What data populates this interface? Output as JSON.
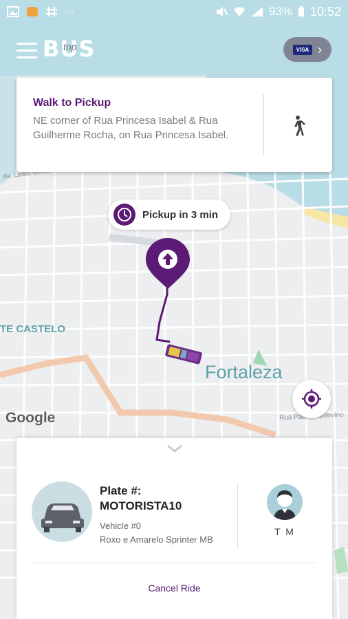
{
  "status_bar": {
    "battery": "93%",
    "time": "10:52"
  },
  "header": {
    "logo_text": "BUS",
    "logo_sub": "top",
    "payment_card_brand": "VISA"
  },
  "walk_card": {
    "title": "Walk to Pickup",
    "description": "NE corner of Rua Princesa Isabel & Rua Guilherme Rocha, on Rua Princesa Isabel."
  },
  "pickup_eta": "Pickup in 3 min",
  "map": {
    "city_label": "Fortaleza",
    "district_label": "TE CASTELO",
    "street_label_1": "Av. Leste Oeste",
    "street_label_2": "Rua Padre Valdevino",
    "attribution": "Google"
  },
  "ride": {
    "plate_label": "Plate #:",
    "plate_value": "MOTORISTA10",
    "vehicle_number": "Vehicle #0",
    "vehicle_description": "Roxo e Amarelo Sprinter MB",
    "driver_initials": "T M",
    "cancel_label": "Cancel Ride"
  },
  "colors": {
    "brand_purple": "#5b1a73",
    "city_label": "#5fa0a7"
  },
  "icons": {
    "menu": "hamburger-icon",
    "walk": "walking-person-icon",
    "clock": "clock-icon",
    "pickup_pin": "pickup-pin-icon",
    "bus": "bus-icon",
    "locate": "locate-target-icon",
    "handle": "chevron-down-icon",
    "car": "car-icon",
    "driver": "driver-avatar-icon"
  }
}
